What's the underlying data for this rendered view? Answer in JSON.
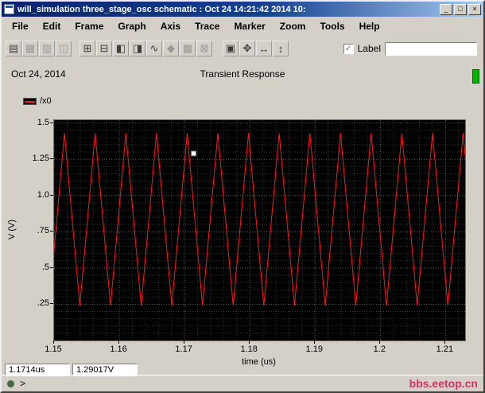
{
  "window": {
    "title": "will_simulation three_stage_osc schematic : Oct 24 14:21:42 2014 10:",
    "controls": [
      {
        "name": "minimize-button",
        "glyph": "_"
      },
      {
        "name": "maximize-button",
        "glyph": "□"
      },
      {
        "name": "close-button",
        "glyph": "×"
      }
    ]
  },
  "menu": {
    "items": [
      "File",
      "Edit",
      "Frame",
      "Graph",
      "Axis",
      "Trace",
      "Marker",
      "Zoom",
      "Tools",
      "Help"
    ]
  },
  "toolbar": {
    "icons": [
      {
        "name": "print-icon",
        "glyph": "▤",
        "dim": false
      },
      {
        "name": "redraw-icon",
        "glyph": "▦",
        "dim": true
      },
      {
        "name": "strip-chart-icon",
        "glyph": "▥",
        "dim": true
      },
      {
        "name": "composite-chart-icon",
        "glyph": "◫",
        "dim": true
      },
      {
        "name": "subwindow-add-icon",
        "glyph": "⊞",
        "dim": false
      },
      {
        "name": "subwindow-delete-icon",
        "glyph": "⊟",
        "dim": false
      },
      {
        "name": "copy-window-icon",
        "glyph": "◧",
        "dim": false
      },
      {
        "name": "paste-window-icon",
        "glyph": "◨",
        "dim": false
      },
      {
        "name": "trace-edit-icon",
        "glyph": "∿",
        "dim": false
      },
      {
        "name": "marker-add-icon",
        "glyph": "◆",
        "dim": true
      },
      {
        "name": "slider-icon",
        "glyph": "▩",
        "dim": true
      },
      {
        "name": "zoom-box-icon",
        "glyph": "⊠",
        "dim": true
      },
      {
        "name": "zoom-fit-icon",
        "glyph": "▣",
        "dim": false
      },
      {
        "name": "pan-icon",
        "glyph": "✥",
        "dim": false
      },
      {
        "name": "zoom-x-icon",
        "glyph": "↔",
        "dim": false
      },
      {
        "name": "zoom-y-icon",
        "glyph": "↕",
        "dim": false
      }
    ],
    "label_checkbox": "Label",
    "checkbox_glyph": "✓",
    "label_value": ""
  },
  "header": {
    "date": "Oct 24, 2014",
    "title": "Transient Response"
  },
  "pane_indicator_color": "#00b400",
  "legend": {
    "items": [
      {
        "label": "/x0",
        "color": "#ff1a1a"
      }
    ]
  },
  "chart_data": {
    "type": "line",
    "title": "Transient Response",
    "xlabel": "time (us)",
    "ylabel": "V (V)",
    "xlim": [
      1.15,
      1.213
    ],
    "ylim": [
      0,
      1.52
    ],
    "xticks": {
      "values": [
        1.15,
        1.16,
        1.17,
        1.18,
        1.19,
        1.2,
        1.21
      ],
      "labels": [
        "1.15",
        "1.16",
        "1.17",
        "1.18",
        "1.19",
        "1.2",
        "1.21"
      ]
    },
    "yticks": {
      "values": [
        1.5,
        1.25,
        1.0,
        0.75,
        0.5,
        0.25
      ],
      "labels": [
        "1.5",
        "1.25",
        "1.0",
        ".75",
        ".5",
        ".25"
      ]
    },
    "grid": {
      "style": "dotted",
      "x_minor_step": 0.002,
      "y_minor_step": 0.05,
      "minor_color": "#343434",
      "major_color": "#5a5a5a"
    },
    "background": "#000000",
    "legend_position": "above-top-left",
    "series": [
      {
        "name": "/x0",
        "color": "#ff1a1a",
        "waveform": "triangle",
        "v_min": 0.24,
        "v_max": 1.43,
        "period_us": 0.0047,
        "points": [
          [
            1.14925,
            0.24
          ],
          [
            1.1516,
            1.43
          ],
          [
            1.15395,
            0.24
          ],
          [
            1.1563,
            1.43
          ],
          [
            1.15865,
            0.24
          ],
          [
            1.161,
            1.43
          ],
          [
            1.16335,
            0.24
          ],
          [
            1.1657,
            1.43
          ],
          [
            1.16805,
            0.24
          ],
          [
            1.1704,
            1.43
          ],
          [
            1.17275,
            0.24
          ],
          [
            1.1751,
            1.43
          ],
          [
            1.17745,
            0.24
          ],
          [
            1.1798,
            1.43
          ],
          [
            1.18215,
            0.24
          ],
          [
            1.1845,
            1.43
          ],
          [
            1.18685,
            0.24
          ],
          [
            1.1892,
            1.43
          ],
          [
            1.19155,
            0.24
          ],
          [
            1.1939,
            1.43
          ],
          [
            1.19625,
            0.24
          ],
          [
            1.1986,
            1.43
          ],
          [
            1.20095,
            0.24
          ],
          [
            1.2033,
            1.43
          ],
          [
            1.20565,
            0.24
          ],
          [
            1.208,
            1.43
          ],
          [
            1.21035,
            0.24
          ],
          [
            1.2127,
            1.43
          ],
          [
            1.21505,
            0.24
          ]
        ]
      }
    ],
    "cursor": {
      "t_us": 1.1714,
      "v": 1.29017
    }
  },
  "readouts": {
    "x": "1.1714us",
    "y": "1.29017V"
  },
  "statusbar": {
    "prompt": ">",
    "watermark": "bbs.eetop.cn",
    "watermark_color": "#cc3366"
  }
}
